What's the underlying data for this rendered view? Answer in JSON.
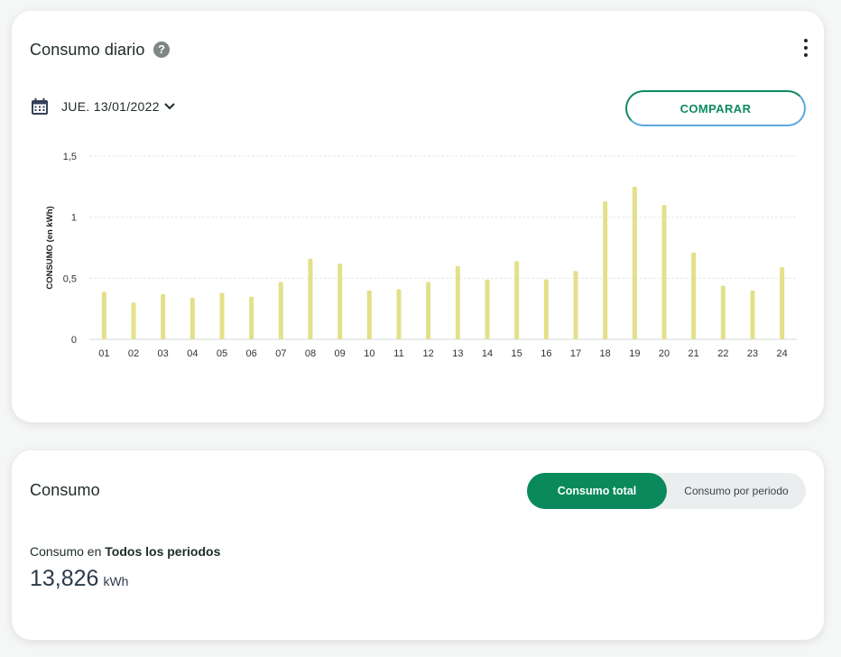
{
  "daily": {
    "title": "Consumo diario",
    "help_icon": "question-circle-icon",
    "menu_icon": "kebab-menu-icon",
    "date": "JUE. 13/01/2022",
    "calendar_icon": "calendar-icon",
    "chevron_icon": "chevron-down-icon",
    "compare_label": "COMPARAR"
  },
  "chart_data": {
    "type": "bar",
    "title": "",
    "xlabel": "",
    "ylabel": "CONSUMO (en kWh)",
    "ylim": [
      0,
      1.5
    ],
    "yticks": [
      "0",
      "0,5",
      "1",
      "1,5"
    ],
    "grid": true,
    "bar_color": "#e3e089",
    "categories": [
      "01",
      "02",
      "03",
      "04",
      "05",
      "06",
      "07",
      "08",
      "09",
      "10",
      "11",
      "12",
      "13",
      "14",
      "15",
      "16",
      "17",
      "18",
      "19",
      "20",
      "21",
      "22",
      "23",
      "24"
    ],
    "values": [
      0.39,
      0.3,
      0.37,
      0.34,
      0.38,
      0.35,
      0.47,
      0.66,
      0.62,
      0.4,
      0.41,
      0.47,
      0.6,
      0.49,
      0.64,
      0.49,
      0.56,
      1.13,
      1.25,
      1.1,
      0.71,
      0.44,
      0.4,
      0.59
    ]
  },
  "consumo": {
    "title": "Consumo",
    "toggle_active": "Consumo total",
    "toggle_inactive": "Consumo por periodo",
    "summary_prefix": "Consumo en ",
    "summary_period": "Todos los periodos",
    "total_value": "13,826",
    "total_unit": "kWh"
  },
  "colors": {
    "accent_green": "#0a8a5c",
    "bar": "#e3e089",
    "outline_blue": "#5aa7e0"
  }
}
